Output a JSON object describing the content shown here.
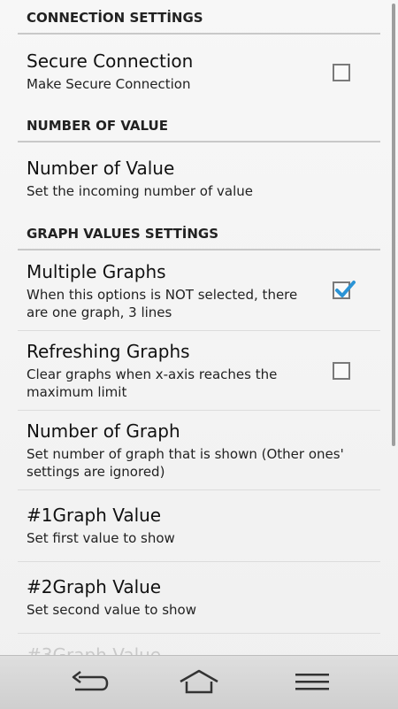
{
  "sections": {
    "connection": {
      "header": "CONNECTİON SETTİNGS"
    },
    "number": {
      "header": "NUMBER OF VALUE"
    },
    "graph": {
      "header": "GRAPH VALUES SETTİNGS"
    }
  },
  "prefs": {
    "secure": {
      "title": "Secure Connection",
      "summary": "Make Secure Connection",
      "checked": false
    },
    "number_of_value": {
      "title": "Number of Value",
      "summary": "Set the incoming number of value"
    },
    "multiple_graphs": {
      "title": "Multiple Graphs",
      "summary": "When this options is NOT selected, there are one graph, 3 lines",
      "checked": true
    },
    "refreshing_graphs": {
      "title": "Refreshing Graphs",
      "summary": "Clear graphs when x-axis reaches the maximum limit",
      "checked": false
    },
    "number_of_graph": {
      "title": "Number of Graph",
      "summary": "Set number of graph that is shown (Other ones' settings are ignored)"
    },
    "graph1": {
      "title": "#1Graph Value",
      "summary": "Set first value to show"
    },
    "graph2": {
      "title": "#2Graph Value",
      "summary": "Set second value to show"
    },
    "graph3_partial": {
      "title": "#3Graph Value"
    }
  },
  "colors": {
    "accent": "#2a93d5",
    "section_line": "#c8c8c8"
  },
  "navbar": {
    "icons": [
      "back-icon",
      "home-icon",
      "menu-icon"
    ]
  }
}
